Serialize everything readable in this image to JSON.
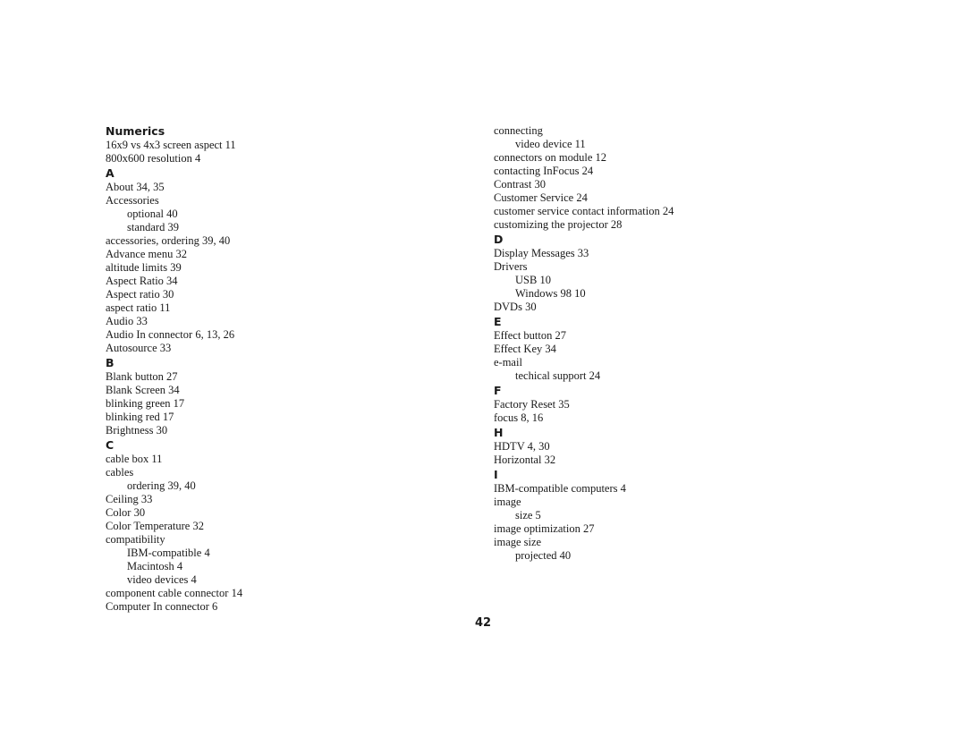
{
  "page": {
    "number": "42"
  },
  "columns": [
    {
      "items": [
        {
          "type": "heading",
          "text": "Numerics"
        },
        {
          "type": "entry",
          "text": "16x9 vs 4x3 screen aspect 11"
        },
        {
          "type": "entry",
          "text": "800x600 resolution 4"
        },
        {
          "type": "heading",
          "text": "A"
        },
        {
          "type": "entry",
          "text": "About 34, 35"
        },
        {
          "type": "entry",
          "text": "Accessories"
        },
        {
          "type": "sub",
          "text": "optional 40"
        },
        {
          "type": "sub",
          "text": "standard 39"
        },
        {
          "type": "entry",
          "text": "accessories, ordering 39, 40"
        },
        {
          "type": "entry",
          "text": "Advance menu 32"
        },
        {
          "type": "entry",
          "text": "altitude limits 39"
        },
        {
          "type": "entry",
          "text": "Aspect Ratio 34"
        },
        {
          "type": "entry",
          "text": "Aspect ratio 30"
        },
        {
          "type": "entry",
          "text": "aspect ratio 11"
        },
        {
          "type": "entry",
          "text": "Audio 33"
        },
        {
          "type": "entry",
          "text": "Audio In connector 6, 13, 26"
        },
        {
          "type": "entry",
          "text": "Autosource 33"
        },
        {
          "type": "heading",
          "text": "B"
        },
        {
          "type": "entry",
          "text": "Blank button 27"
        },
        {
          "type": "entry",
          "text": "Blank Screen 34"
        },
        {
          "type": "entry",
          "text": "blinking green 17"
        },
        {
          "type": "entry",
          "text": "blinking red 17"
        },
        {
          "type": "entry",
          "text": "Brightness 30"
        },
        {
          "type": "heading",
          "text": "C"
        },
        {
          "type": "entry",
          "text": "cable box 11"
        },
        {
          "type": "entry",
          "text": "cables"
        },
        {
          "type": "sub",
          "text": "ordering 39, 40"
        },
        {
          "type": "entry",
          "text": "Ceiling 33"
        },
        {
          "type": "entry",
          "text": "Color 30"
        },
        {
          "type": "entry",
          "text": "Color Temperature 32"
        },
        {
          "type": "entry",
          "text": "compatibility"
        },
        {
          "type": "sub",
          "text": "IBM-compatible 4"
        },
        {
          "type": "sub",
          "text": "Macintosh 4"
        },
        {
          "type": "sub",
          "text": "video devices 4"
        },
        {
          "type": "entry",
          "text": "component cable connector 14"
        },
        {
          "type": "entry",
          "text": "Computer In connector 6"
        }
      ]
    },
    {
      "items": [
        {
          "type": "entry",
          "text": "connecting"
        },
        {
          "type": "sub",
          "text": "video device 11"
        },
        {
          "type": "entry",
          "text": "connectors on module 12"
        },
        {
          "type": "entry",
          "text": "contacting InFocus 24"
        },
        {
          "type": "entry",
          "text": "Contrast 30"
        },
        {
          "type": "entry",
          "text": "Customer Service 24"
        },
        {
          "type": "entry",
          "text": "customer service contact information 24"
        },
        {
          "type": "entry",
          "text": "customizing the projector 28"
        },
        {
          "type": "heading",
          "text": "D"
        },
        {
          "type": "entry",
          "text": "Display Messages 33"
        },
        {
          "type": "entry",
          "text": "Drivers"
        },
        {
          "type": "sub",
          "text": "USB 10"
        },
        {
          "type": "sub",
          "text": "Windows 98 10"
        },
        {
          "type": "entry",
          "text": "DVDs 30"
        },
        {
          "type": "heading",
          "text": "E"
        },
        {
          "type": "entry",
          "text": "Effect button 27"
        },
        {
          "type": "entry",
          "text": "Effect Key 34"
        },
        {
          "type": "entry",
          "text": "e-mail"
        },
        {
          "type": "sub",
          "text": "techical support 24"
        },
        {
          "type": "heading",
          "text": "F"
        },
        {
          "type": "entry",
          "text": "Factory Reset 35"
        },
        {
          "type": "entry",
          "text": "focus 8, 16"
        },
        {
          "type": "heading",
          "text": "H"
        },
        {
          "type": "entry",
          "text": "HDTV 4, 30"
        },
        {
          "type": "entry",
          "text": "Horizontal 32"
        },
        {
          "type": "heading",
          "text": "I"
        },
        {
          "type": "entry",
          "text": "IBM-compatible computers 4"
        },
        {
          "type": "entry",
          "text": "image"
        },
        {
          "type": "sub",
          "text": "size 5"
        },
        {
          "type": "entry",
          "text": "image optimization 27"
        },
        {
          "type": "entry",
          "text": "image size"
        },
        {
          "type": "sub",
          "text": "projected 40"
        }
      ]
    }
  ]
}
